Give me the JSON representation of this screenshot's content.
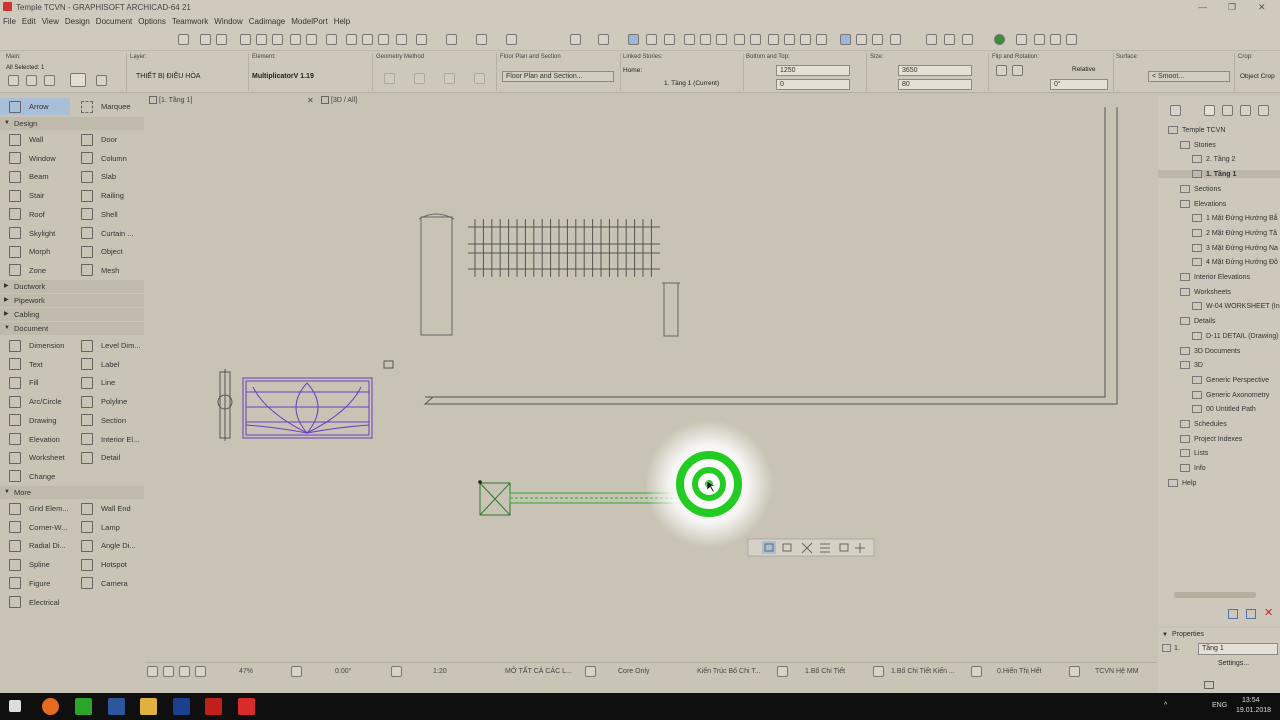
{
  "window": {
    "title": "Temple TCVN - GRAPHISOFT ARCHICAD-64 21"
  },
  "menu": [
    "File",
    "Edit",
    "View",
    "Design",
    "Document",
    "Options",
    "Teamwork",
    "Window",
    "Cadimage",
    "ModelPort",
    "Help"
  ],
  "infobox": {
    "main_label": "Main:",
    "selection": "All Selected: 1",
    "layer_label": "Layer:",
    "layer_value": "THIẾT BỊ ĐIỀU HÒA",
    "element_label": "Element:",
    "element_value": "MultiplicatorV 1.19",
    "geometry_label": "Geometry Method",
    "floorplan_label": "Floor Plan and Section",
    "floorplan_value": "Floor Plan and Section...",
    "linked_label": "Linked Stories:",
    "home_label": "Home:",
    "home_value": "1. Tầng 1 (Current)",
    "bottom_top_label": "Bottom and Top:",
    "bottom_top_1": "1250",
    "bottom_top_2": "0",
    "size_label": "Size:",
    "size_1": "3650",
    "size_2": "80",
    "flip_label": "Flip and Rotation:",
    "relative": "Relative",
    "rotation": "0°",
    "surface_label": "Surface:",
    "surface_value": "< Smoot...",
    "crop_label": "Crop:",
    "crop_value": "Object Crop"
  },
  "tabs": {
    "tab1": "[1. Tầng 1]",
    "tab2": "[3D / All]"
  },
  "toolbox": {
    "arrow": "Arrow",
    "marquee": "Marquee",
    "design": "Design",
    "tools_design": [
      "Wall",
      "Door",
      "Window",
      "Column",
      "Beam",
      "Slab",
      "Stair",
      "Railing",
      "Roof",
      "Shell",
      "Skylight",
      "Curtain ...",
      "Morph",
      "Object",
      "Zone",
      "Mesh"
    ],
    "ductwork": "Ductwork",
    "pipework": "Pipework",
    "cabling": "Cabling",
    "document": "Document",
    "tools_document": [
      "Dimension",
      "Level Dim...",
      "Text",
      "Label",
      "Fill",
      "Line",
      "Arc/Circle",
      "Polyline",
      "Drawing",
      "Section",
      "Elevation",
      "Interior El...",
      "Worksheet",
      "Detail",
      "Change",
      ""
    ],
    "more": "More",
    "tools_more": [
      "Grid Elem...",
      "Wall End",
      "Corner-W...",
      "Lamp",
      "Radial Di...",
      "Angle Di...",
      "Spline",
      "Hotspot",
      "Figure",
      "Camera",
      "Electrical",
      ""
    ]
  },
  "navigator": {
    "items": [
      {
        "label": "Temple TCVN",
        "level": 0
      },
      {
        "label": "Stories",
        "level": 1
      },
      {
        "label": "2. Tầng 2",
        "level": 2
      },
      {
        "label": "1. Tầng 1",
        "level": 2,
        "selected": true
      },
      {
        "label": "Sections",
        "level": 1
      },
      {
        "label": "Elevations",
        "level": 1
      },
      {
        "label": "1 Mặt Đứng Hướng Bắ",
        "level": 2
      },
      {
        "label": "2 Mặt Đứng Hướng Tâ",
        "level": 2
      },
      {
        "label": "3 Mặt Đứng Hướng Na",
        "level": 2
      },
      {
        "label": "4 Mặt Đứng Hướng Đô",
        "level": 2
      },
      {
        "label": "Interior Elevations",
        "level": 1
      },
      {
        "label": "Worksheets",
        "level": 1
      },
      {
        "label": "W-04 WORKSHEET (Ind",
        "level": 2
      },
      {
        "label": "Details",
        "level": 1
      },
      {
        "label": "D-11 DETAIL (Drawing)",
        "level": 2
      },
      {
        "label": "3D Documents",
        "level": 1
      },
      {
        "label": "3D",
        "level": 1
      },
      {
        "label": "Generic Perspective",
        "level": 2
      },
      {
        "label": "Generic Axonometry",
        "level": 2
      },
      {
        "label": "00 Untitled Path",
        "level": 2
      },
      {
        "label": "Schedules",
        "level": 1
      },
      {
        "label": "Project Indexes",
        "level": 1
      },
      {
        "label": "Lists",
        "level": 1
      },
      {
        "label": "Info",
        "level": 1
      },
      {
        "label": "Help",
        "level": 0
      }
    ]
  },
  "properties": {
    "header": "Properties",
    "id": "1.",
    "story": "Tầng 1",
    "settings": "Settings..."
  },
  "statusbar": {
    "zoom": "47%",
    "angle": "0.00°",
    "scale": "1:20",
    "layer_combo": "MỞ TẤT CẢ CÁC L...",
    "structure": "Core Only",
    "model_view": "Kiến Trúc Bổ Chi T...",
    "pen_set": "1.Bổ Chi Tiết",
    "dim": "1.Bổ Chi Tiết Kiến ...",
    "renovation": "0.Hiển Thị Hết",
    "standard": "TCVN Hệ MM"
  },
  "tray": {
    "lang": "ENG",
    "time": "13:54",
    "date": "19.01.2018"
  },
  "colors": {
    "accent_green": "#22cc22",
    "purple": "#6a3fc0",
    "background": "#c8c3b4"
  }
}
